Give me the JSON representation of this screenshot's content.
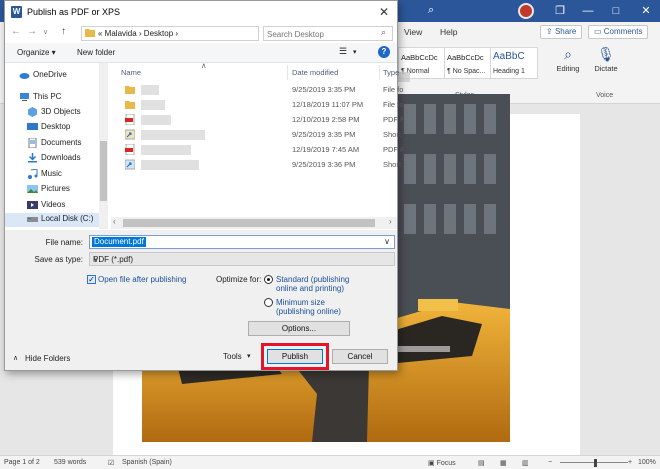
{
  "word": {
    "ribbon_tabs": [
      "View",
      "Help"
    ],
    "share_label": "Share",
    "comments_label": "Comments",
    "styles": [
      {
        "sample": "AaBbCcDc",
        "name": "¶ Normal"
      },
      {
        "sample": "AaBbCcDc",
        "name": "¶ No Spac..."
      },
      {
        "sample": "AaBbC",
        "name": "Heading 1"
      }
    ],
    "styles_group_label": "Styles",
    "editing_label": "Editing",
    "dictate_label": "Dictate",
    "voice_group_label": "Voice",
    "status": {
      "page": "Page 1 of 2",
      "words": "539 words",
      "language": "Spanish (Spain)",
      "focus": "Focus",
      "zoom": "100%"
    }
  },
  "dialog": {
    "title": "Publish as PDF or XPS",
    "breadcrumbs": "« Malavida › Desktop ›",
    "search_placeholder": "Search Desktop",
    "organize_label": "Organize ▾",
    "new_folder_label": "New folder",
    "nav_items": [
      {
        "label": "OneDrive",
        "icon": "cloud-icon"
      },
      {
        "label": "This PC",
        "icon": "computer-icon"
      },
      {
        "label": "3D Objects",
        "icon": "3d-objects-icon"
      },
      {
        "label": "Desktop",
        "icon": "desktop-icon"
      },
      {
        "label": "Documents",
        "icon": "documents-icon"
      },
      {
        "label": "Downloads",
        "icon": "downloads-icon"
      },
      {
        "label": "Music",
        "icon": "music-icon"
      },
      {
        "label": "Pictures",
        "icon": "pictures-icon"
      },
      {
        "label": "Videos",
        "icon": "videos-icon"
      },
      {
        "label": "Local Disk (C:)",
        "icon": "drive-icon"
      }
    ],
    "columns": {
      "name": "Name",
      "date": "Date modified",
      "type": "Type"
    },
    "files": [
      {
        "icon": "folder-icon",
        "date": "9/25/2019 3:35 PM",
        "type": "File fo"
      },
      {
        "icon": "folder-icon",
        "date": "12/18/2019 11:07 PM",
        "type": "File fo"
      },
      {
        "icon": "pdf-icon",
        "date": "12/10/2019 2:58 PM",
        "type": "PDF F"
      },
      {
        "icon": "shortcut-icon",
        "date": "9/25/2019 3:35 PM",
        "type": "Short"
      },
      {
        "icon": "pdf-icon",
        "date": "12/19/2019 7:45 AM",
        "type": "PDF F"
      },
      {
        "icon": "shortcut-icon",
        "date": "9/25/2019 3:36 PM",
        "type": "Short"
      }
    ],
    "file_name_label": "File name:",
    "file_name_value": "Document.pdf",
    "save_type_label": "Save as type:",
    "save_type_value": "PDF (*.pdf)",
    "open_after_label": "Open file after publishing",
    "optimize_label": "Optimize for:",
    "standard_label_1": "Standard (publishing",
    "standard_label_2": "online and printing)",
    "minimum_label_1": "Minimum size",
    "minimum_label_2": "(publishing online)",
    "options_label": "Options...",
    "hide_folders_label": "Hide Folders",
    "tools_label": "Tools",
    "publish_label": "Publish",
    "cancel_label": "Cancel",
    "highlight_color": "#e2162b"
  }
}
